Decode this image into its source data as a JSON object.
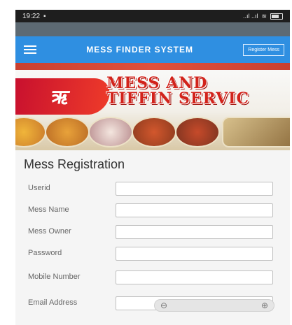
{
  "status_bar": {
    "time": "19:22",
    "signal_text": "..ıl ..ıl"
  },
  "app_bar": {
    "title": "MESS FINDER SYSTEM",
    "register_button": "Register Mess"
  },
  "banner": {
    "logo_text": "ऋ",
    "line1": "MESS AND",
    "line2": "TIFFIN SERVIC"
  },
  "form": {
    "title": "Mess Registration",
    "fields": [
      {
        "label": "Userid",
        "value": ""
      },
      {
        "label": "Mess Name",
        "value": ""
      },
      {
        "label": "Mess Owner",
        "value": ""
      },
      {
        "label": "Password",
        "value": ""
      },
      {
        "label": "Mobile Number",
        "value": ""
      },
      {
        "label": "Email Address",
        "value": ""
      }
    ]
  },
  "colors": {
    "app_bar": "#2f8fe1",
    "status_bar": "#1e1e1e",
    "banner_red": "#d2231b"
  },
  "icons": {
    "menu": "hamburger-icon",
    "zoom_out": "zoom-out-icon",
    "zoom_in": "zoom-in-icon"
  }
}
